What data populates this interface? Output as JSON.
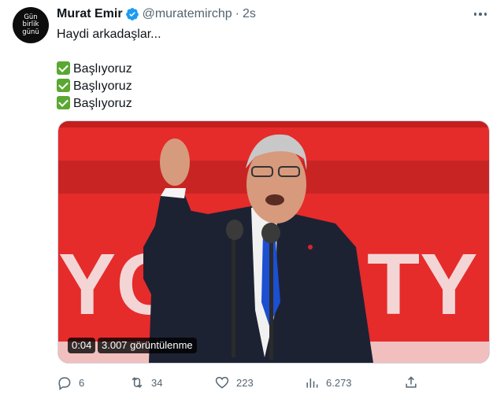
{
  "author": {
    "avatar_lines": [
      "Gün",
      "birlik",
      "günü"
    ],
    "name": "Murat Emir",
    "handle": "@muratemirchp",
    "separator": "·",
    "time": "2s"
  },
  "tweet": {
    "line1": "Haydi arkadaşlar...",
    "list": [
      "Başlıyoruz",
      "Başlıyoruz",
      "Başlıyoruz"
    ]
  },
  "video": {
    "duration": "0:04",
    "views": "3.007 görüntülenme",
    "background_letters": "YOR",
    "background_letters_right": "TY D"
  },
  "actions": {
    "replies": "6",
    "retweets": "34",
    "likes": "223",
    "views": "6.273"
  },
  "colors": {
    "verified": "#1d9bf0",
    "check": "#5aa832",
    "stage_red": "#e62b2b",
    "muted": "#536471"
  },
  "icons": [
    "verified-badge-icon",
    "more-icon",
    "check-icon",
    "reply-icon",
    "retweet-icon",
    "like-icon",
    "views-icon",
    "share-icon"
  ]
}
